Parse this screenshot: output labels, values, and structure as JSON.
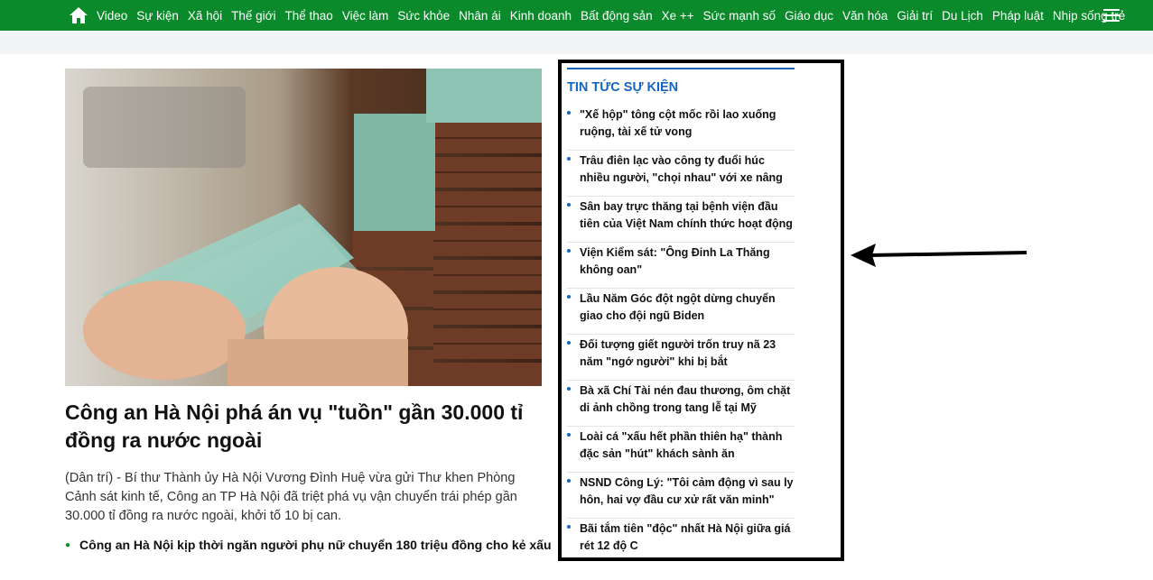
{
  "nav": {
    "items": [
      "Video",
      "Sự kiện",
      "Xã hội",
      "Thế giới",
      "Thể thao",
      "Việc làm",
      "Sức khỏe",
      "Nhân ái",
      "Kinh doanh",
      "Bất động sản",
      "Xe ++",
      "Sức mạnh số",
      "Giáo dục",
      "Văn hóa",
      "Giải trí",
      "Du Lịch",
      "Pháp luật",
      "Nhịp sống trẻ"
    ],
    "color": "#0a8a2a"
  },
  "article": {
    "headline": "Công an Hà Nội phá án vụ \"tuồn\" gần 30.000 tỉ đồng ra nước ngoài",
    "summary": "(Dân trí) - Bí thư Thành ủy Hà Nội Vương Đình Huệ vừa gửi Thư khen Phòng Cảnh sát kinh tế, Công an TP Hà Nội đã triệt phá vụ vận chuyển trái phép gần 30.000 tỉ đồng ra nước ngoài, khởi tố 10 bị can.",
    "related": "Công an Hà Nội kịp thời ngăn người phụ nữ chuyển 180 triệu đồng cho kẻ xấu"
  },
  "sidebar": {
    "title": "TIN TỨC SỰ KIỆN",
    "items": [
      "\"Xế hộp\" tông cột mốc rồi lao xuống ruộng, tài xế tử vong",
      "Trâu điên lạc vào công ty đuổi húc nhiều người, \"chọi nhau\" với xe nâng",
      "Sân bay trực thăng tại bệnh viện đầu tiên của Việt Nam chính thức hoạt động",
      "Viện Kiểm sát: \"Ông Đinh La Thăng không oan\"",
      "Lầu Năm Góc đột ngột dừng chuyển giao cho đội ngũ Biden",
      "Đối tượng giết người trốn truy nã 23 năm \"ngớ người\" khi bị bắt",
      "Bà xã Chí Tài nén đau thương, ôm chặt di ảnh chồng trong tang lễ tại Mỹ",
      "Loài cá \"xấu hết phần thiên hạ\" thành đặc sản \"hút\" khách sành ăn",
      "NSND Công Lý: \"Tôi cảm động vì sau ly hôn, hai vợ đầu cư xử rất văn minh\"",
      "Bãi tắm tiên \"độc\" nhất Hà Nội giữa giá rét 12 độ C"
    ],
    "accent": "#1565c0"
  },
  "icons": {
    "home": "home-icon",
    "menu": "hamburger-menu-icon",
    "annotation": "arrow-left-icon"
  }
}
